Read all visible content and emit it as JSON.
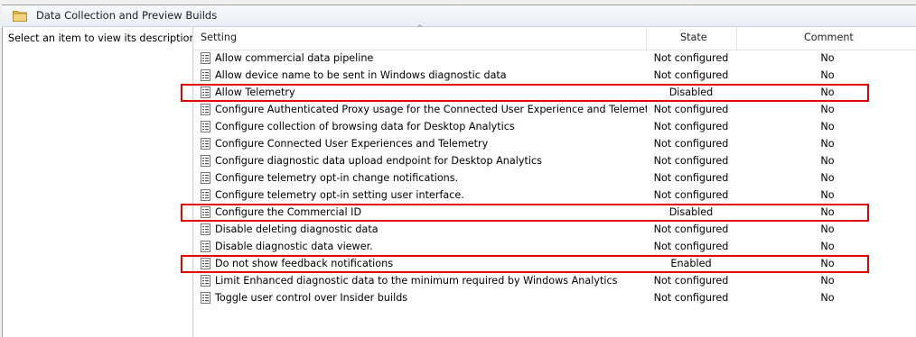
{
  "header": {
    "title": "Data Collection and Preview Builds",
    "icon": "folder-icon"
  },
  "description_pane": {
    "text": "Select an item to view its description."
  },
  "columns": {
    "setting": "Setting",
    "state": "State",
    "comment": "Comment",
    "sort_indicator": "^"
  },
  "rows": [
    {
      "name": "Allow commercial data pipeline",
      "state": "Not configured",
      "comment": "No"
    },
    {
      "name": "Allow device name to be sent in Windows diagnostic data",
      "state": "Not configured",
      "comment": "No"
    },
    {
      "name": "Allow Telemetry",
      "state": "Disabled",
      "comment": "No",
      "highlighted": true
    },
    {
      "name": "Configure Authenticated Proxy usage for the Connected User Experience and Telemetry ...",
      "state": "Not configured",
      "comment": "No"
    },
    {
      "name": "Configure collection of browsing data for Desktop Analytics",
      "state": "Not configured",
      "comment": "No"
    },
    {
      "name": "Configure Connected User Experiences and Telemetry",
      "state": "Not configured",
      "comment": "No"
    },
    {
      "name": "Configure diagnostic data upload endpoint for Desktop Analytics",
      "state": "Not configured",
      "comment": "No"
    },
    {
      "name": "Configure telemetry opt-in change notifications.",
      "state": "Not configured",
      "comment": "No"
    },
    {
      "name": "Configure telemetry opt-in setting user interface.",
      "state": "Not configured",
      "comment": "No"
    },
    {
      "name": "Configure the Commercial ID",
      "state": "Disabled",
      "comment": "No",
      "highlighted": true
    },
    {
      "name": "Disable deleting diagnostic data",
      "state": "Not configured",
      "comment": "No"
    },
    {
      "name": "Disable diagnostic data viewer.",
      "state": "Not configured",
      "comment": "No"
    },
    {
      "name": "Do not show feedback notifications",
      "state": "Enabled",
      "comment": "No",
      "highlighted": true
    },
    {
      "name": "Limit Enhanced diagnostic data to the minimum required by Windows Analytics",
      "state": "Not configured",
      "comment": "No"
    },
    {
      "name": "Toggle user control over Insider builds",
      "state": "Not configured",
      "comment": "No"
    }
  ],
  "colors": {
    "highlight_border": "#e00000",
    "folder": "#e8c060"
  }
}
